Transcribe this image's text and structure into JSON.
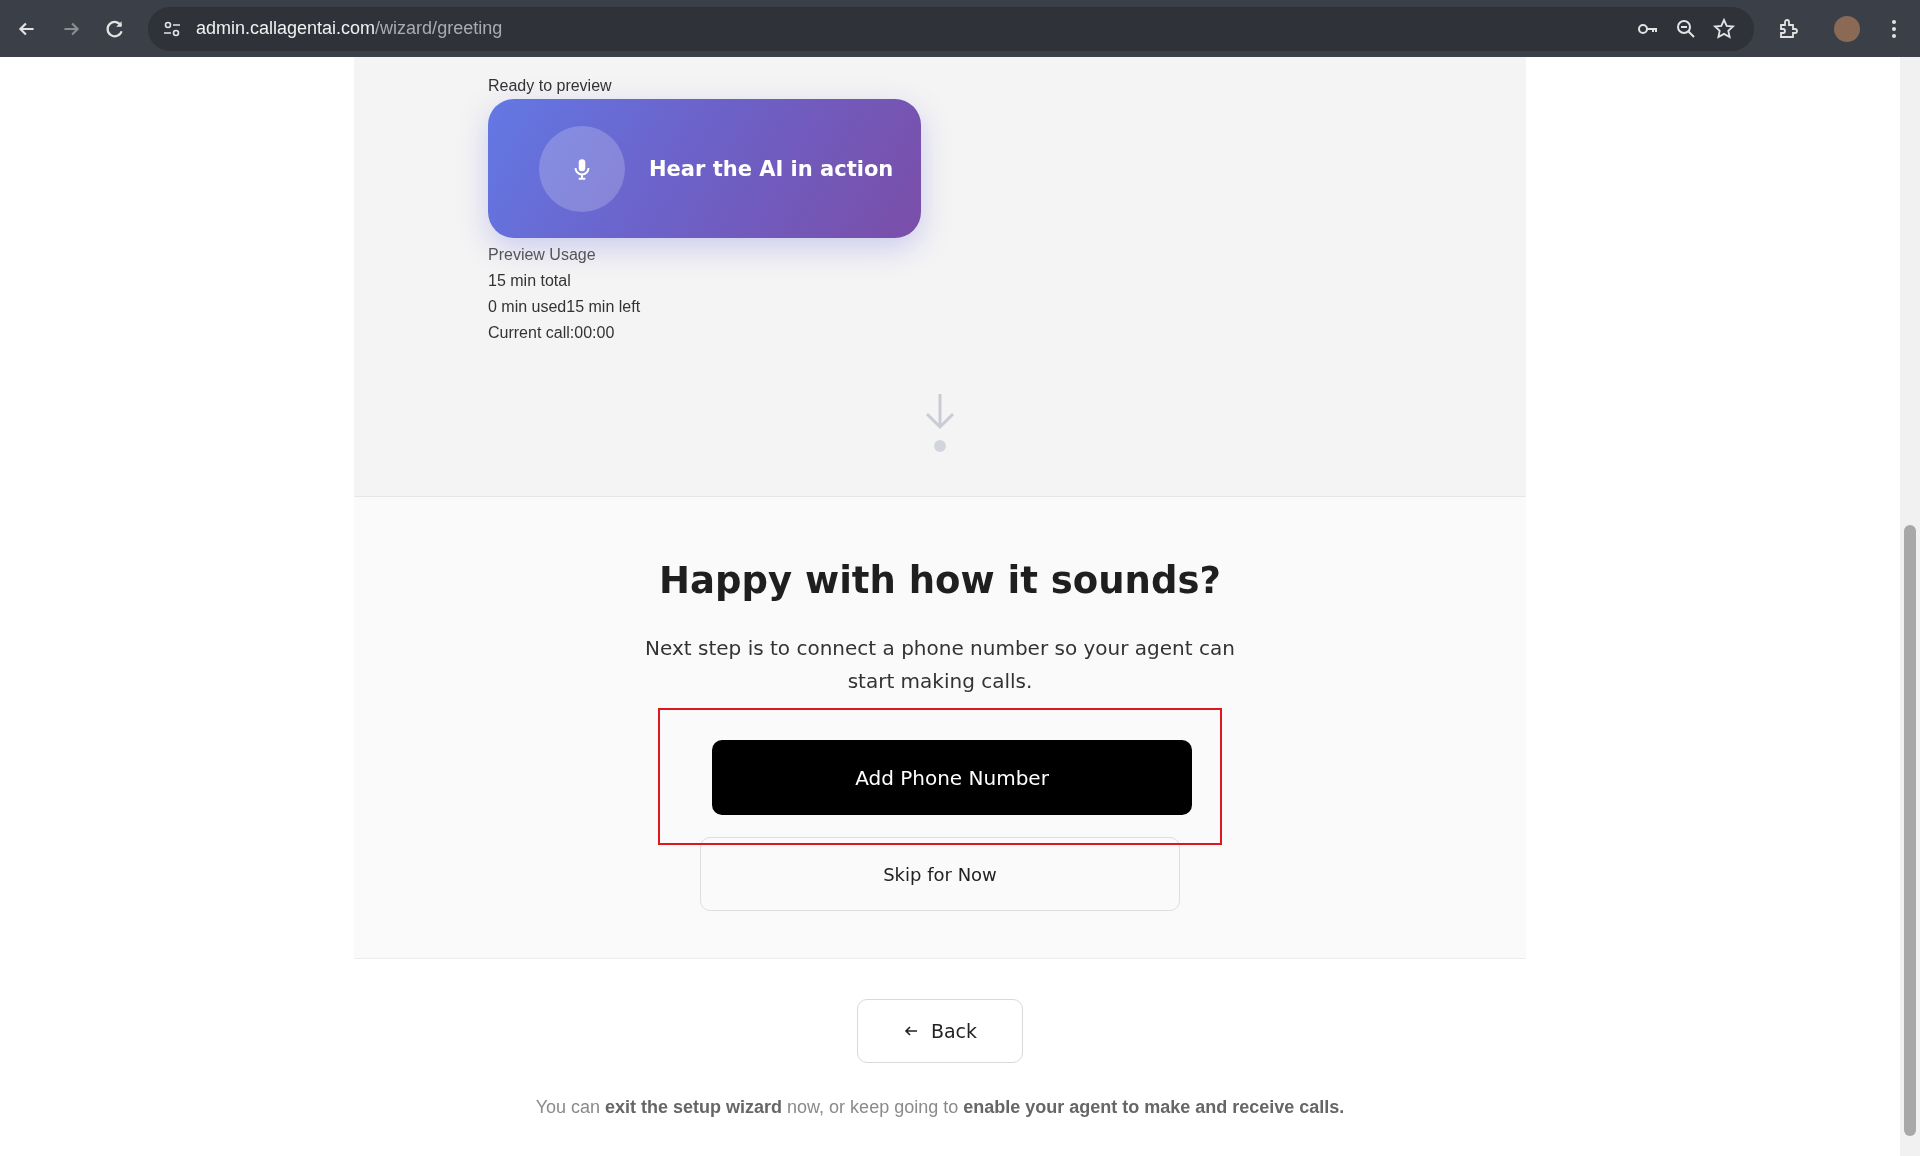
{
  "browser": {
    "url_host": "admin.callagentai.com",
    "url_path": "/wizard/greeting"
  },
  "preview": {
    "label": "Ready to preview",
    "button_label": "Hear the AI in action",
    "usage_title": "Preview Usage",
    "usage_lines": [
      "15 min total",
      "0 min used15 min left",
      "Current call:00:00"
    ]
  },
  "prompt": {
    "heading": "Happy with how it sounds?",
    "text": "Next step is to connect a phone number so your agent can start making calls.",
    "buttons": [
      {
        "label": "Add Phone Number",
        "kind": "primary",
        "highlighted": true
      },
      {
        "label": "Skip for Now",
        "kind": "secondary",
        "highlighted": false
      }
    ]
  },
  "footer": {
    "back_label": "Back",
    "note": "You can **exit the setup wizard** now, or keep going to **enable your agent to make and receive calls.**"
  }
}
